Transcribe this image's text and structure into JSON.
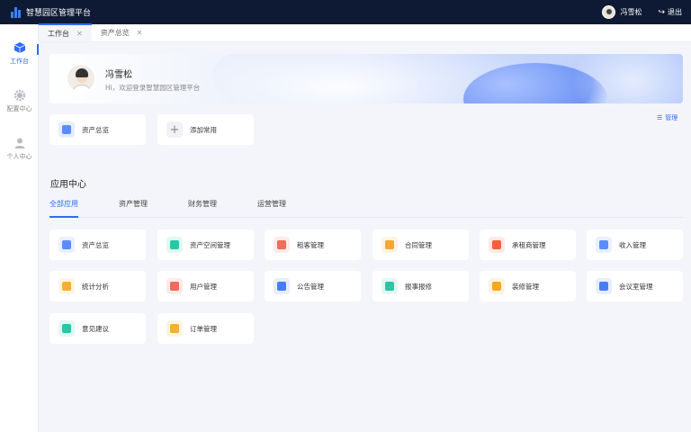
{
  "app": {
    "title": "智慧园区管理平台"
  },
  "header": {
    "username": "冯雪松",
    "logout_label": "退出"
  },
  "sidebar": {
    "items": [
      {
        "label": "工作台",
        "icon": "cube-icon",
        "active": true
      },
      {
        "label": "配置中心",
        "icon": "gear-icon",
        "active": false
      },
      {
        "label": "个人中心",
        "icon": "user-icon",
        "active": false
      }
    ]
  },
  "tabs": [
    {
      "label": "工作台",
      "active": true
    },
    {
      "label": "资产总览",
      "active": false
    }
  ],
  "banner": {
    "name": "冯雪松",
    "greeting": "Hi，欢迎登录智慧园区管理平台"
  },
  "shortcuts": {
    "manage_label": "管理",
    "items": [
      {
        "label": "资产总览",
        "icon": "asset-overview-icon",
        "color": "#5b8cff"
      },
      {
        "label": "添加常用",
        "icon": "plus-icon",
        "color": "#f1f2f5"
      }
    ]
  },
  "app_center": {
    "title": "应用中心",
    "categories": [
      {
        "label": "全部应用",
        "active": true
      },
      {
        "label": "资产管理",
        "active": false
      },
      {
        "label": "财务管理",
        "active": false
      },
      {
        "label": "运营管理",
        "active": false
      }
    ],
    "apps": [
      {
        "label": "资产总览",
        "icon": "asset-overview-icon",
        "color": "#5b8cff"
      },
      {
        "label": "资产空间管理",
        "icon": "space-icon",
        "color": "#2bc6a4"
      },
      {
        "label": "租客管理",
        "icon": "tenant-icon",
        "color": "#f26b5b"
      },
      {
        "label": "合同管理",
        "icon": "contract-icon",
        "color": "#f7a531"
      },
      {
        "label": "承租商管理",
        "icon": "lessee-icon",
        "color": "#f0603e"
      },
      {
        "label": "收入管理",
        "icon": "cloud-icon",
        "color": "#5b8cff"
      },
      {
        "label": "统计分析",
        "icon": "pie-chart-icon",
        "color": "#f5b030"
      },
      {
        "label": "用户管理",
        "icon": "user-manage-icon",
        "color": "#f26b5b"
      },
      {
        "label": "公告管理",
        "icon": "notice-icon",
        "color": "#4a7cf7"
      },
      {
        "label": "报事报修",
        "icon": "repair-icon",
        "color": "#2bc6a4"
      },
      {
        "label": "装修管理",
        "icon": "decoration-icon",
        "color": "#f5a623"
      },
      {
        "label": "会议室管理",
        "icon": "meeting-room-icon",
        "color": "#4a7cf7"
      },
      {
        "label": "意见建议",
        "icon": "feedback-icon",
        "color": "#2bc6a4"
      },
      {
        "label": "订单管理",
        "icon": "order-icon",
        "color": "#f5b030"
      }
    ]
  }
}
